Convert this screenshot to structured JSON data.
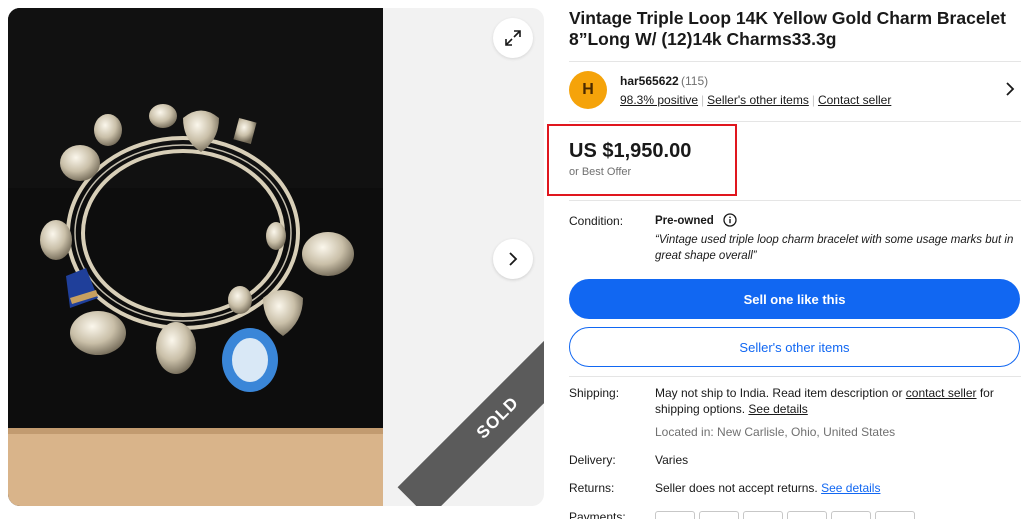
{
  "title": "Vintage Triple Loop 14K Yellow Gold Charm Bracelet 8”Long W/ (12)14k Charms33.3g",
  "gallery": {
    "sold_label": "SOLD",
    "expand_icon": "expand-icon",
    "next_icon": "chevron-right-icon"
  },
  "seller": {
    "avatar_letter": "H",
    "avatar_color": "#f5a30a",
    "name": "har565622",
    "feedback_count": "(115)",
    "positive": "98.3% positive",
    "other_items": "Seller's other items",
    "contact": "Contact seller"
  },
  "price": {
    "amount": "US $1,950.00",
    "best_offer": "or Best Offer",
    "highlight_color": "#e0161e"
  },
  "condition": {
    "label": "Condition:",
    "value": "Pre-owned",
    "description": "“Vintage used triple loop charm bracelet with some usage marks but in great shape overall”"
  },
  "buttons": {
    "primary": "Sell one like this",
    "secondary": "Seller's other items",
    "accent": "#1167f2"
  },
  "shipping": {
    "label": "Shipping:",
    "text_before": "May not ship to India. Read item description or ",
    "contact_link": "contact seller",
    "text_after": " for shipping options. ",
    "details_link": "See details",
    "location": "Located in: New Carlisle, Ohio, United States"
  },
  "delivery": {
    "label": "Delivery:",
    "value": "Varies"
  },
  "returns": {
    "label": "Returns:",
    "value": "Seller does not accept returns. ",
    "link": "See details"
  },
  "payments": {
    "label": "Payments:",
    "icons": [
      "paypal-icon",
      "googlepay-icon",
      "venmo-icon",
      "mastercard-icon",
      "discover-icon",
      "diners-icon"
    ]
  }
}
